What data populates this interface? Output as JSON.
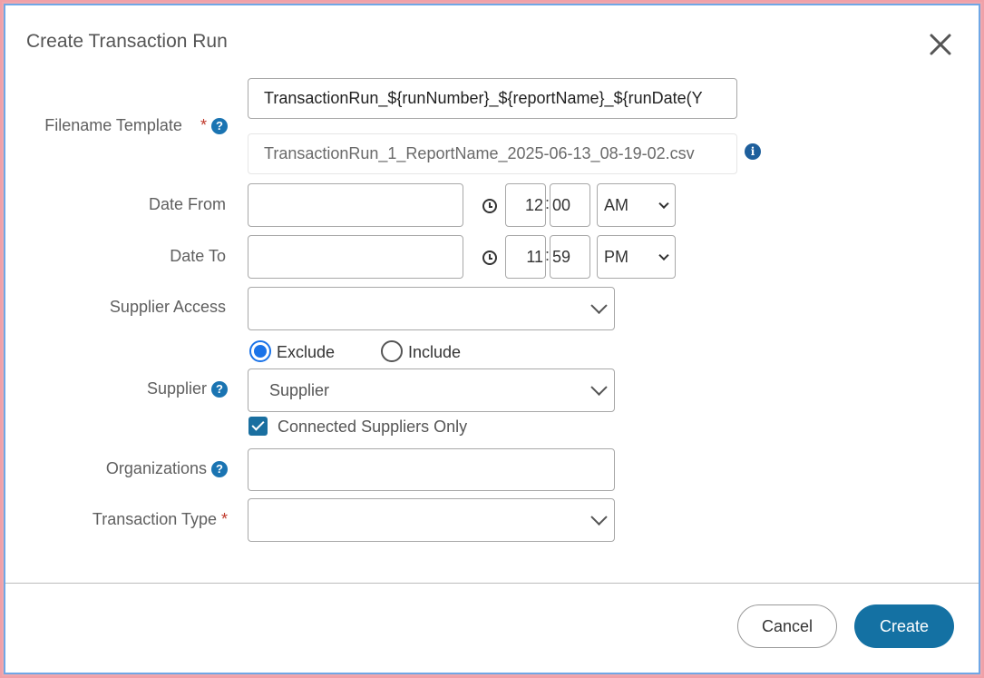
{
  "dialog": {
    "title": "Create Transaction Run",
    "close_icon": "close-icon"
  },
  "form": {
    "filename_template": {
      "label": "Filename Template",
      "required_mark": "*",
      "help_icon": "?",
      "value": "TransactionRun_${runNumber}_${reportName}_${runDate(Y",
      "preview": "TransactionRun_1_ReportName_2025-06-13_08-19-02.csv",
      "info_icon": "i"
    },
    "date_from": {
      "label": "Date From",
      "value": "",
      "hour": "12",
      "minute": "00",
      "separator": ":",
      "ampm": "AM"
    },
    "date_to": {
      "label": "Date To",
      "value": "",
      "hour": "11",
      "minute": "59",
      "separator": ":",
      "ampm": "PM"
    },
    "supplier_access": {
      "label": "Supplier Access",
      "value": ""
    },
    "supplier_mode": {
      "exclude_label": "Exclude",
      "include_label": "Include",
      "selected": "Exclude"
    },
    "supplier": {
      "label": "Supplier",
      "help_icon": "?",
      "placeholder": "Supplier"
    },
    "connected_only": {
      "label": "Connected Suppliers Only",
      "checked": true
    },
    "organizations": {
      "label": "Organizations",
      "help_icon": "?",
      "value": ""
    },
    "transaction_type": {
      "label": "Transaction Type",
      "required_mark": "*",
      "value": ""
    }
  },
  "footer": {
    "cancel_label": "Cancel",
    "create_label": "Create"
  },
  "colors": {
    "primary": "#1471a3",
    "help": "#1a74b2",
    "radio": "#1a73e8",
    "required": "#c0392b"
  }
}
